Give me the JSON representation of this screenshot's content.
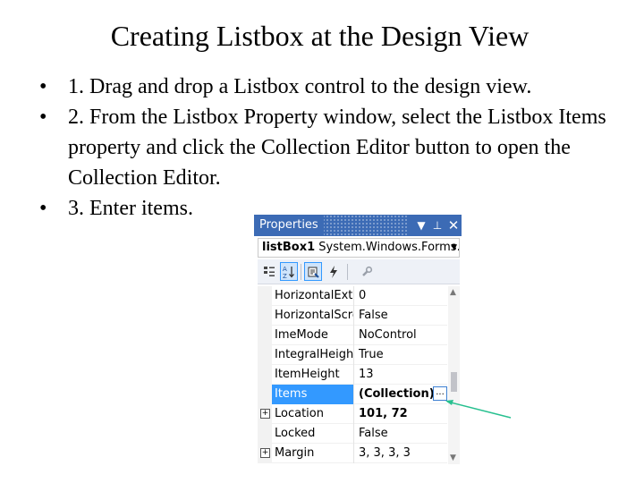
{
  "slide": {
    "title": "Creating Listbox at the Design View",
    "bullets": [
      "1. Drag and drop a Listbox control to the design view.",
      "2. From the Listbox Property window, select the Listbox Items property and click the Collection Editor button to open the Collection Editor.",
      "3. Enter items."
    ]
  },
  "properties_window": {
    "title": "Properties",
    "controls": {
      "dropdown": "▼",
      "pin": "⊥",
      "close": "✕"
    },
    "object_name": "listBox1",
    "object_type": "System.Windows.Forms.Li",
    "toolbar": {
      "categorized_icon": "categorized-icon",
      "alphabetical_icon": "alphabetical-icon",
      "properties_icon": "properties-icon",
      "events_icon": "lightning-icon",
      "property_pages_icon": "wrench-icon"
    },
    "rows": [
      {
        "name": "HorizontalExten",
        "value": "0",
        "expandable": false
      },
      {
        "name": "HorizontalScrol",
        "value": "False",
        "expandable": false
      },
      {
        "name": "ImeMode",
        "value": "NoControl",
        "expandable": false
      },
      {
        "name": "IntegralHeight",
        "value": "True",
        "expandable": false
      },
      {
        "name": "ItemHeight",
        "value": "13",
        "expandable": false
      },
      {
        "name": "Items",
        "value": "(Collection)",
        "expandable": false,
        "selected": true,
        "ellipsis": "..."
      },
      {
        "name": "Location",
        "value": "101, 72",
        "expandable": true,
        "bold": true
      },
      {
        "name": "Locked",
        "value": "False",
        "expandable": false
      },
      {
        "name": "Margin",
        "value": "3, 3, 3, 3",
        "expandable": true
      }
    ]
  },
  "colors": {
    "title_bar": "#3c6bb5",
    "selection": "#3399ff",
    "arrow": "#27c08f"
  }
}
